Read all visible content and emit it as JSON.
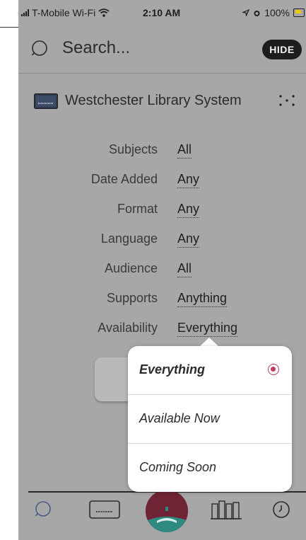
{
  "status_bar": {
    "carrier": "T-Mobile Wi-Fi",
    "time": "2:10 AM",
    "battery": "100%"
  },
  "search": {
    "placeholder": "Search...",
    "hide_label": "HIDE"
  },
  "library": {
    "name": "Westchester Library System"
  },
  "filters": [
    {
      "label": "Subjects",
      "value": "All"
    },
    {
      "label": "Date Added",
      "value": "Any"
    },
    {
      "label": "Format",
      "value": "Any"
    },
    {
      "label": "Language",
      "value": "Any"
    },
    {
      "label": "Audience",
      "value": "All"
    },
    {
      "label": "Supports",
      "value": "Anything"
    },
    {
      "label": "Availability",
      "value": "Everything"
    }
  ],
  "availability_menu": {
    "options": [
      "Everything",
      "Available Now",
      "Coming Soon"
    ],
    "selected": "Everything"
  },
  "icons": {
    "search": "search-icon",
    "library": "library-card-icon",
    "more": "dots-icon",
    "tab_search": "search-icon",
    "tab_card": "library-card-icon",
    "tab_home": "reading-icon",
    "tab_shelf": "shelf-icon",
    "tab_history": "clock-icon"
  },
  "colors": {
    "accent": "#c23a5b",
    "home_tab": "#6e2434",
    "overlay": "#a7a7a7"
  }
}
